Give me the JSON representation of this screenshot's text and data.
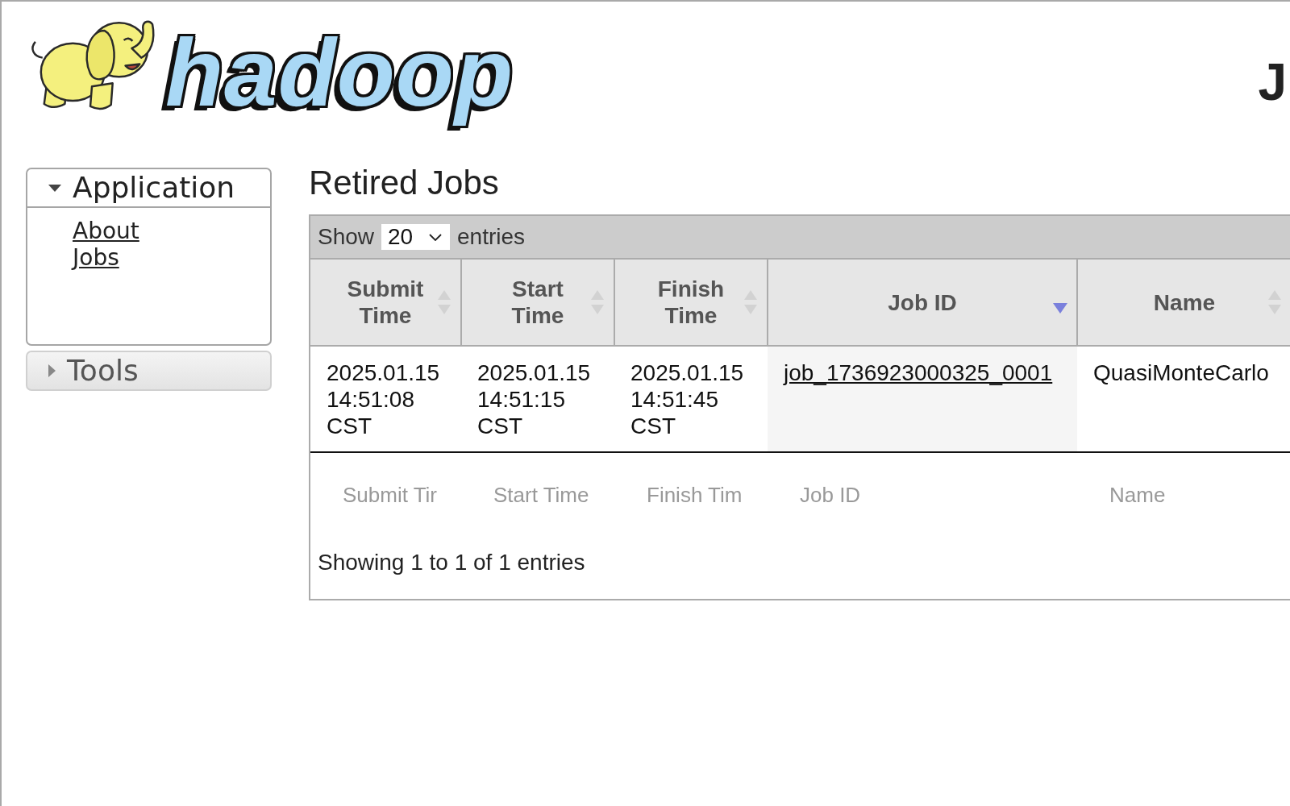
{
  "header": {
    "logo": {
      "wordmark": "hadoop"
    },
    "title": "J"
  },
  "sidebar": {
    "sections": [
      {
        "title": "Application",
        "expanded": true,
        "items": [
          "About",
          "Jobs"
        ]
      },
      {
        "title": "Tools",
        "expanded": false
      }
    ]
  },
  "main": {
    "title": "Retired Jobs",
    "table": {
      "length_menu": {
        "label_before": "Show",
        "value": "20",
        "label_after": "entries"
      },
      "columns": [
        {
          "label": "Submit Time",
          "sorted": false
        },
        {
          "label": "Start Time",
          "sorted": false
        },
        {
          "label": "Finish Time",
          "sorted": false
        },
        {
          "label": "Job ID",
          "sorted": true,
          "descending": true
        },
        {
          "label": "Name",
          "sorted": false
        }
      ],
      "rows": [
        {
          "cells": [
            {
              "kind": "text",
              "text": "2025.01.15 14:51:08 CST"
            },
            {
              "kind": "text",
              "text": "2025.01.15 14:51:15 CST"
            },
            {
              "kind": "text",
              "text": "2025.01.15 14:51:45 CST"
            },
            {
              "kind": "link",
              "text": "job_1736923000325_0001"
            },
            {
              "kind": "text",
              "text": "QuasiMonteCarlo"
            }
          ]
        }
      ],
      "filters": [
        {
          "placeholder": "Submit Tir"
        },
        {
          "placeholder": "Start Time"
        },
        {
          "placeholder": "Finish Tim"
        },
        {
          "placeholder": "Job ID"
        },
        {
          "placeholder": "Name"
        }
      ],
      "info": "Showing 1 to 1 of 1 entries"
    }
  }
}
